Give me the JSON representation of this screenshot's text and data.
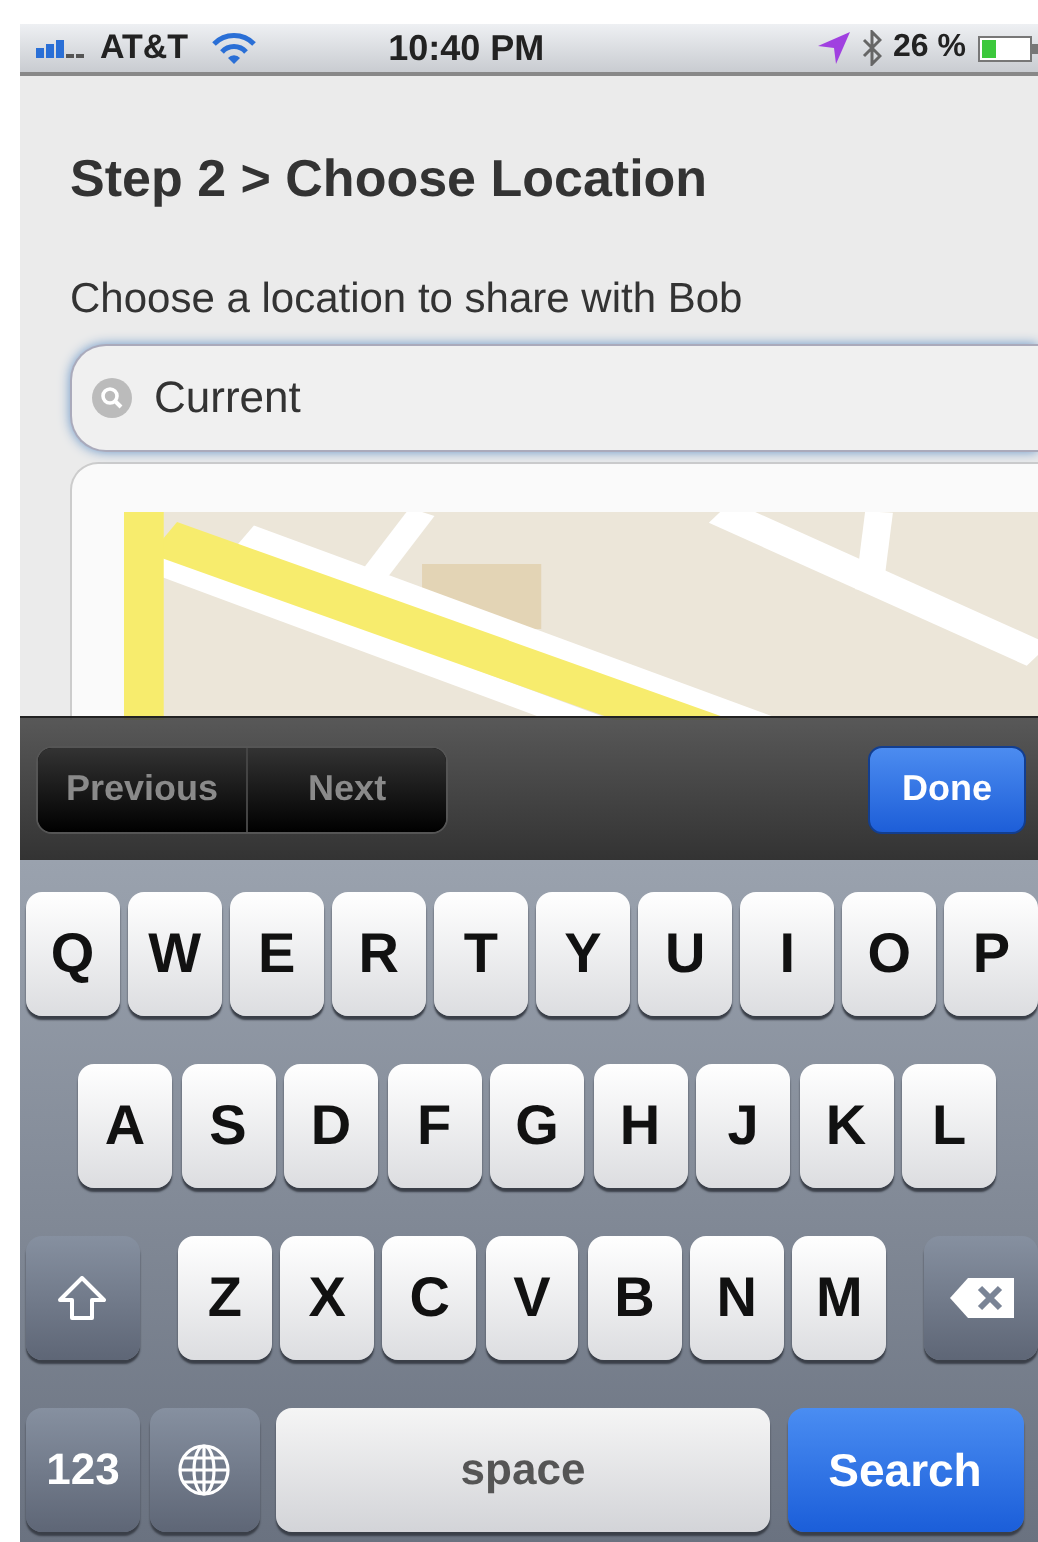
{
  "status_bar": {
    "carrier": "AT&T",
    "time": "10:40 PM",
    "battery": "26 %"
  },
  "page": {
    "title": "Step 2 > Choose Location",
    "prompt": "Choose a location to share with Bob",
    "search": {
      "value": "Current"
    }
  },
  "toolbar": {
    "nav": [
      {
        "label": "Previous",
        "disabled": true
      },
      {
        "label": "Next",
        "disabled": true
      }
    ],
    "done": "Done"
  },
  "keyboard": [
    [
      {
        "kind": "letter",
        "label": "Q"
      },
      {
        "kind": "letter",
        "label": "W"
      },
      {
        "kind": "letter",
        "label": "E"
      },
      {
        "kind": "letter",
        "label": "R"
      },
      {
        "kind": "letter",
        "label": "T"
      },
      {
        "kind": "letter",
        "label": "Y"
      },
      {
        "kind": "letter",
        "label": "U"
      },
      {
        "kind": "letter",
        "label": "I"
      },
      {
        "kind": "letter",
        "label": "O"
      },
      {
        "kind": "letter",
        "label": "P"
      }
    ],
    [
      {
        "kind": "letter",
        "label": "A"
      },
      {
        "kind": "letter",
        "label": "S"
      },
      {
        "kind": "letter",
        "label": "D"
      },
      {
        "kind": "letter",
        "label": "F"
      },
      {
        "kind": "letter",
        "label": "G"
      },
      {
        "kind": "letter",
        "label": "H"
      },
      {
        "kind": "letter",
        "label": "J"
      },
      {
        "kind": "letter",
        "label": "K"
      },
      {
        "kind": "letter",
        "label": "L"
      }
    ],
    [
      {
        "kind": "shift"
      },
      {
        "kind": "letter",
        "label": "Z"
      },
      {
        "kind": "letter",
        "label": "X"
      },
      {
        "kind": "letter",
        "label": "C"
      },
      {
        "kind": "letter",
        "label": "V"
      },
      {
        "kind": "letter",
        "label": "B"
      },
      {
        "kind": "letter",
        "label": "N"
      },
      {
        "kind": "letter",
        "label": "M"
      },
      {
        "kind": "delete"
      }
    ],
    [
      {
        "kind": "mode",
        "label": "123"
      },
      {
        "kind": "globe"
      },
      {
        "kind": "space",
        "label": "space"
      },
      {
        "kind": "action",
        "label": "Search"
      }
    ]
  ]
}
